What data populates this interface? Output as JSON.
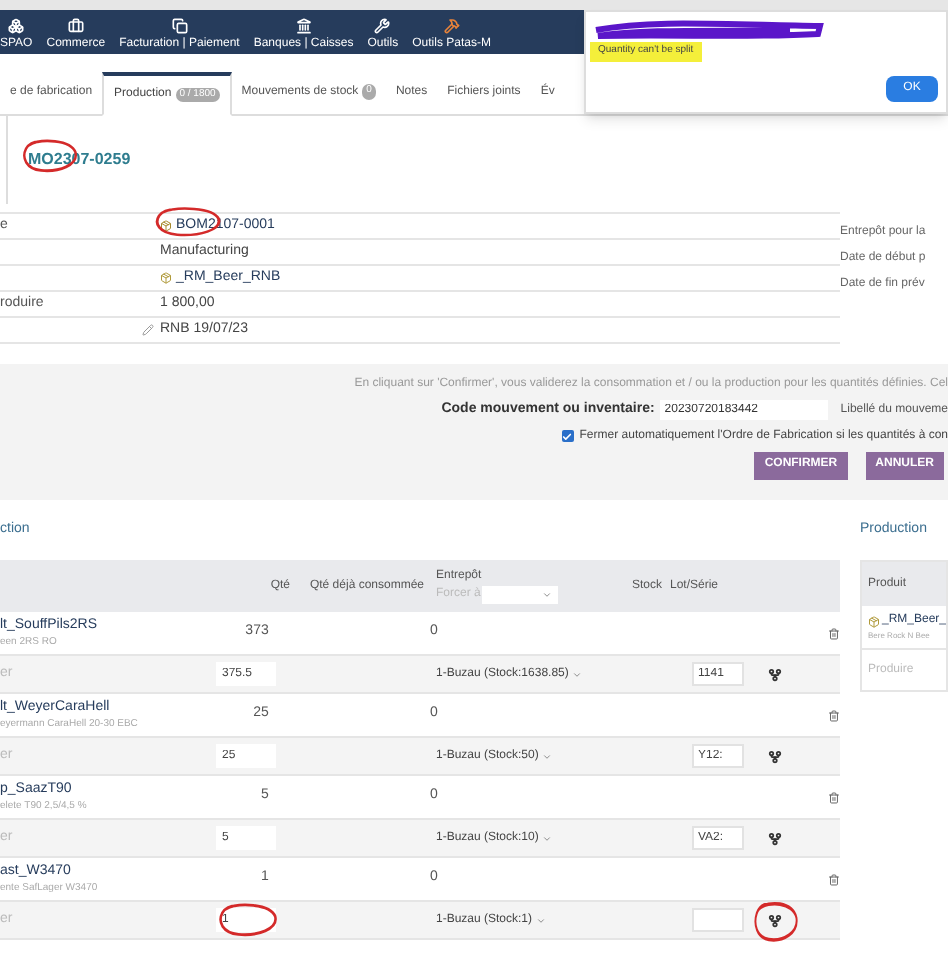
{
  "menu": [
    {
      "label": "SPAO"
    },
    {
      "label": "Commerce"
    },
    {
      "label": "Facturation | Paiement"
    },
    {
      "label": "Banques | Caisses"
    },
    {
      "label": "Outils"
    },
    {
      "label": "Outils Patas-M"
    }
  ],
  "tabs": [
    {
      "label": "e de fabrication",
      "selected": false
    },
    {
      "label": "Production",
      "badge": "0 / 1800",
      "selected": true
    },
    {
      "label": "Mouvements de stock",
      "badge": "0",
      "selected": false
    },
    {
      "label": "Notes",
      "selected": false
    },
    {
      "label": "Fichiers joints",
      "selected": false
    },
    {
      "label": "Év",
      "selected": false
    }
  ],
  "dialog": {
    "message": "Quantity can't be split",
    "button": "OK"
  },
  "reference": {
    "text": "MO2307-0259",
    "circled": true
  },
  "fields": [
    {
      "label": "e",
      "value": "BOM2107-0001",
      "kind": "bom",
      "circled": true
    },
    {
      "value": "Manufacturing",
      "kind": "text"
    },
    {
      "value": "_RM_Beer_RNB",
      "kind": "product"
    },
    {
      "label": "roduire",
      "value": "1 800,00",
      "kind": "text"
    },
    {
      "value": "RNB 19/07/23",
      "kind": "editable"
    }
  ],
  "side_fields": [
    "Entrepôt pour la",
    "Date de début p",
    "Date de fin prév"
  ],
  "confirm": {
    "notice": "En cliquant sur 'Confirmer', vous validerez la consommation et / ou la production pour les quantités définies. Cel",
    "code_label": "Code mouvement ou inventaire:",
    "code_value": "20230720183442",
    "libelle_label": "Libellé du mouveme",
    "autoclose_label": "Fermer automatiquement l'Ordre de Fabrication si les quantités à con",
    "autoclose_checked": true,
    "buttons": [
      "CONFIRMER",
      "ANNULER"
    ]
  },
  "consumption": {
    "title": "ction",
    "columns": [
      "Qté",
      "Qté déjà consommée",
      "Entrepôt",
      "Stock",
      "Lot/Série"
    ],
    "force_label": "Forcer à",
    "rows": [
      {
        "name": "lt_SouffPils2RS",
        "description": "een 2RS RO",
        "qty": "373",
        "consumed": "0",
        "line": {
          "label": "er",
          "qty": "375.5",
          "warehouse": "1-Buzau (Stock:1638.85)",
          "lot": "1141"
        }
      },
      {
        "name": "lt_WeyerCaraHell",
        "description": "eyermann CaraHell 20-30 EBC",
        "qty": "25",
        "consumed": "0",
        "line": {
          "label": "er",
          "qty": "25",
          "warehouse": "1-Buzau (Stock:50)",
          "lot": "Y12:"
        }
      },
      {
        "name": "p_SaazT90",
        "description": "elete T90 2,5/4,5 %",
        "qty": "5",
        "consumed": "0",
        "line": {
          "label": "er",
          "qty": "5",
          "warehouse": "1-Buzau (Stock:10)",
          "lot": "VA2:"
        }
      },
      {
        "name": "ast_W3470",
        "description": "ente SafLager W3470",
        "qty": "1",
        "consumed": "0",
        "line": {
          "label": "er",
          "qty": "1",
          "qty_circled": true,
          "warehouse": "1-Buzau (Stock:1)",
          "split_circled": true
        }
      }
    ]
  },
  "production": {
    "title": "Production",
    "column": "Produit",
    "product": "_RM_Beer_",
    "description": "Bere Rock N Bee",
    "action": "Produire"
  }
}
